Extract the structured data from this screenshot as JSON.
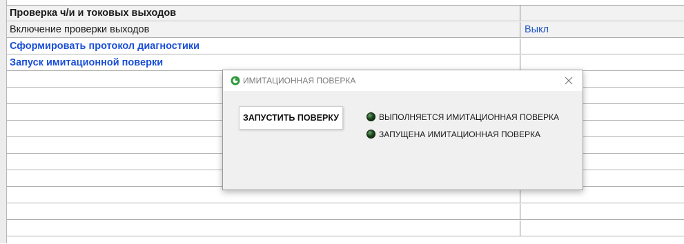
{
  "table": {
    "rows": [
      {
        "label": "Проверка ч/и и токовых выходов",
        "value": ""
      },
      {
        "label": "Включение проверки выходов",
        "value": "Выкл"
      },
      {
        "label": "Сформировать протокол диагностики",
        "value": ""
      },
      {
        "label": "Запуск имитационной поверки",
        "value": ""
      }
    ]
  },
  "dialog": {
    "title": "ИМИТАЦИОННАЯ ПОВЕРКА",
    "start_button": "ЗАПУСТИТЬ ПОВЕРКУ",
    "indicators": [
      {
        "label": "ВЫПОЛНЯЕТСЯ ИМИТАЦИОННАЯ ПОВЕРКА",
        "state": "off"
      },
      {
        "label": "ЗАПУЩЕНА ИМИТАЦИОННАЯ ПОВЕРКА",
        "state": "off"
      }
    ],
    "indicator_color": "#1e4a1e"
  },
  "colors": {
    "link": "#1a4fd6",
    "value_text": "#1f55c4"
  }
}
